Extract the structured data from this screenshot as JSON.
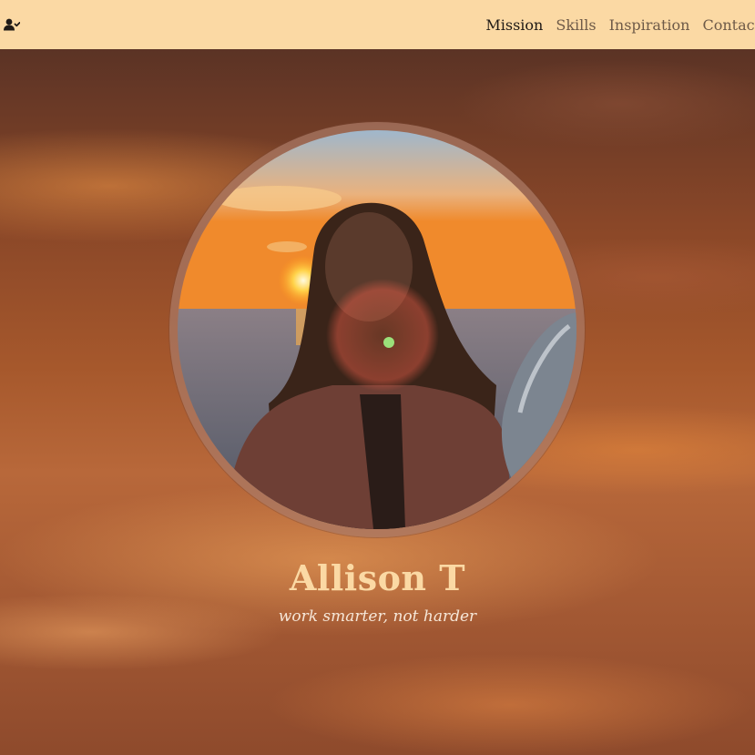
{
  "nav": {
    "brand_icon": "user-check-icon",
    "links": [
      {
        "label": "Mission",
        "active": true
      },
      {
        "label": "Skills",
        "active": false
      },
      {
        "label": "Inspiration",
        "active": false
      },
      {
        "label": "Contact",
        "active": false
      }
    ]
  },
  "hero": {
    "name": "Allison T",
    "tagline": "work smarter, not harder"
  },
  "colors": {
    "navbar_bg": "#fbd9a4",
    "active_link": "#1f1a16",
    "inactive_link": "#6e5a48",
    "name_text": "#fbd9a4"
  }
}
